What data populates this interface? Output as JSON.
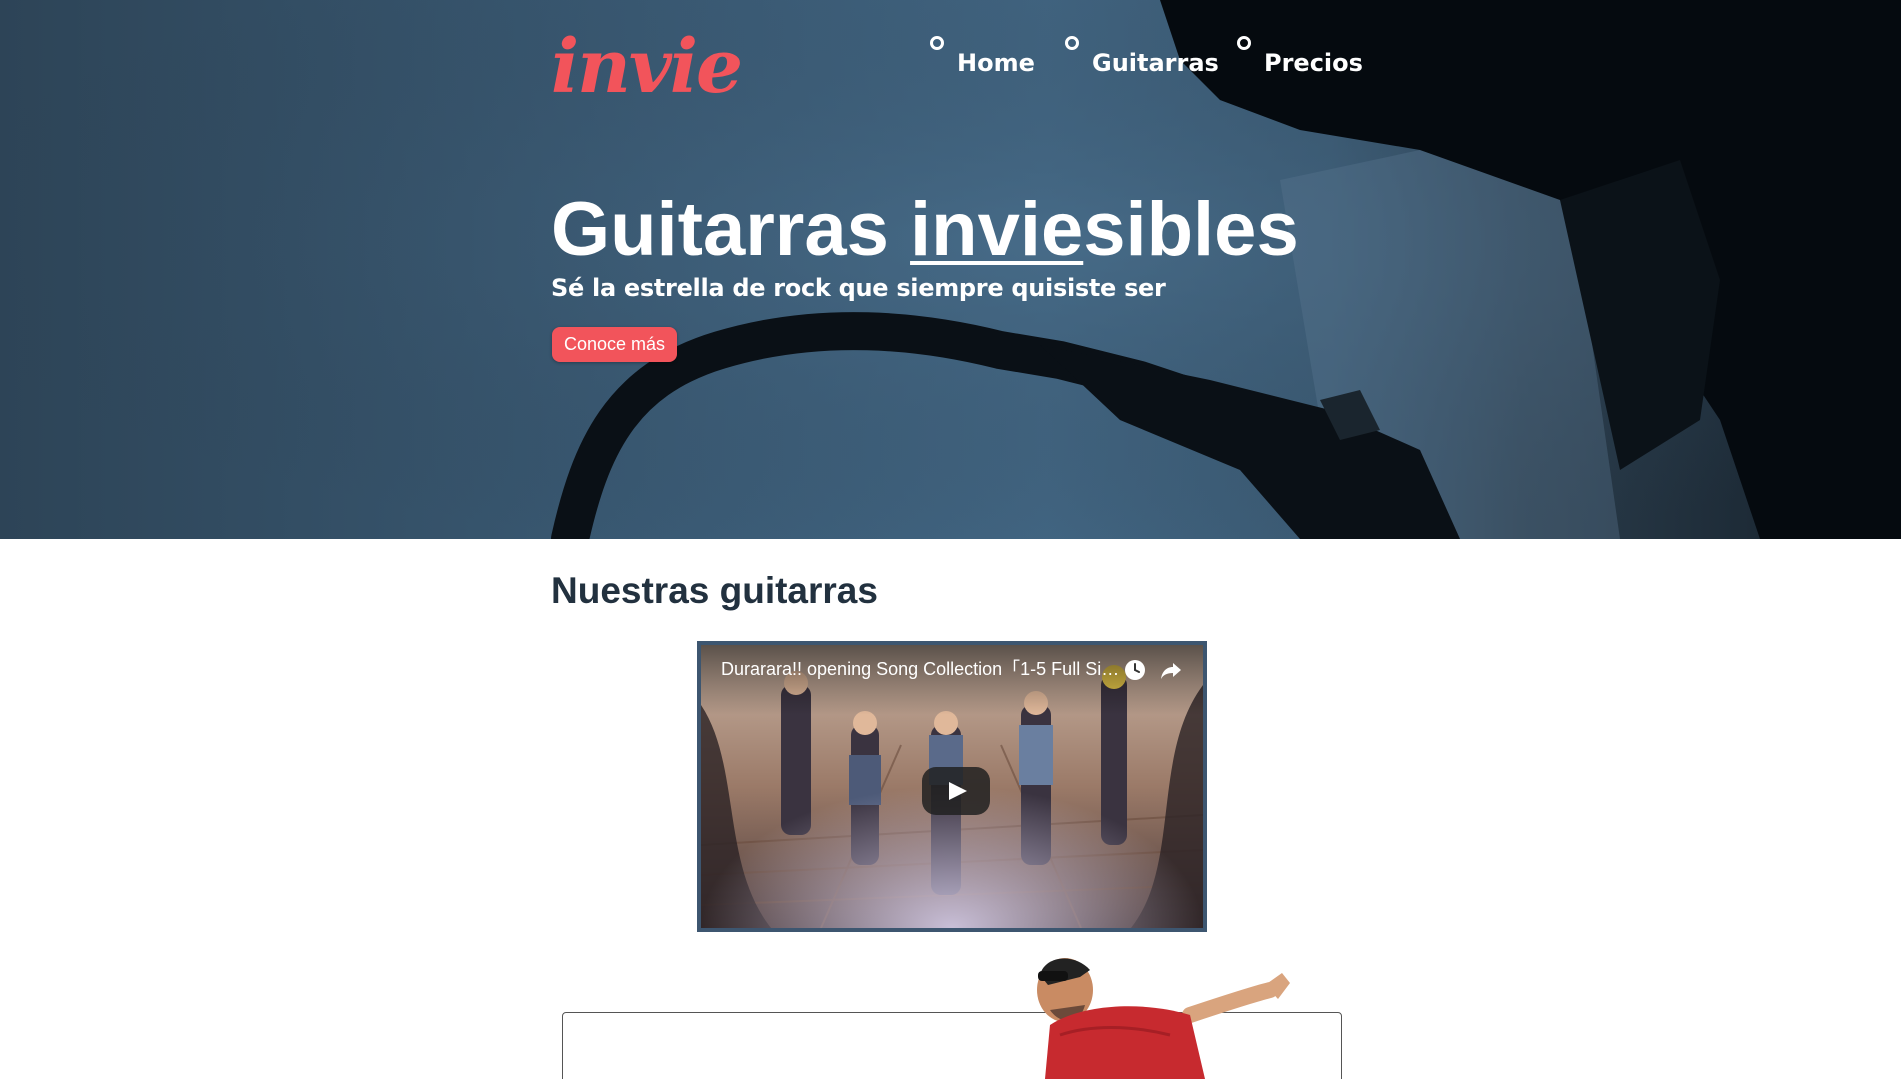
{
  "brand": {
    "logo_text": "invie",
    "accent": "#f2545b"
  },
  "nav": {
    "items": [
      {
        "label": "Home"
      },
      {
        "label": "Guitarras"
      },
      {
        "label": "Precios"
      }
    ]
  },
  "hero": {
    "title_prefix": "Guitarras ",
    "title_underlined": "invie",
    "title_suffix": "sibles",
    "subtitle": "Sé la estrella de rock que siempre quisiste ser",
    "cta_label": "Conoce más"
  },
  "section": {
    "title": "Nuestras guitarras"
  },
  "video": {
    "title": "Durarara!! opening Song Collection「1-5 Full Siz...",
    "icons": [
      "watch-later-icon",
      "share-icon",
      "play-icon"
    ]
  }
}
